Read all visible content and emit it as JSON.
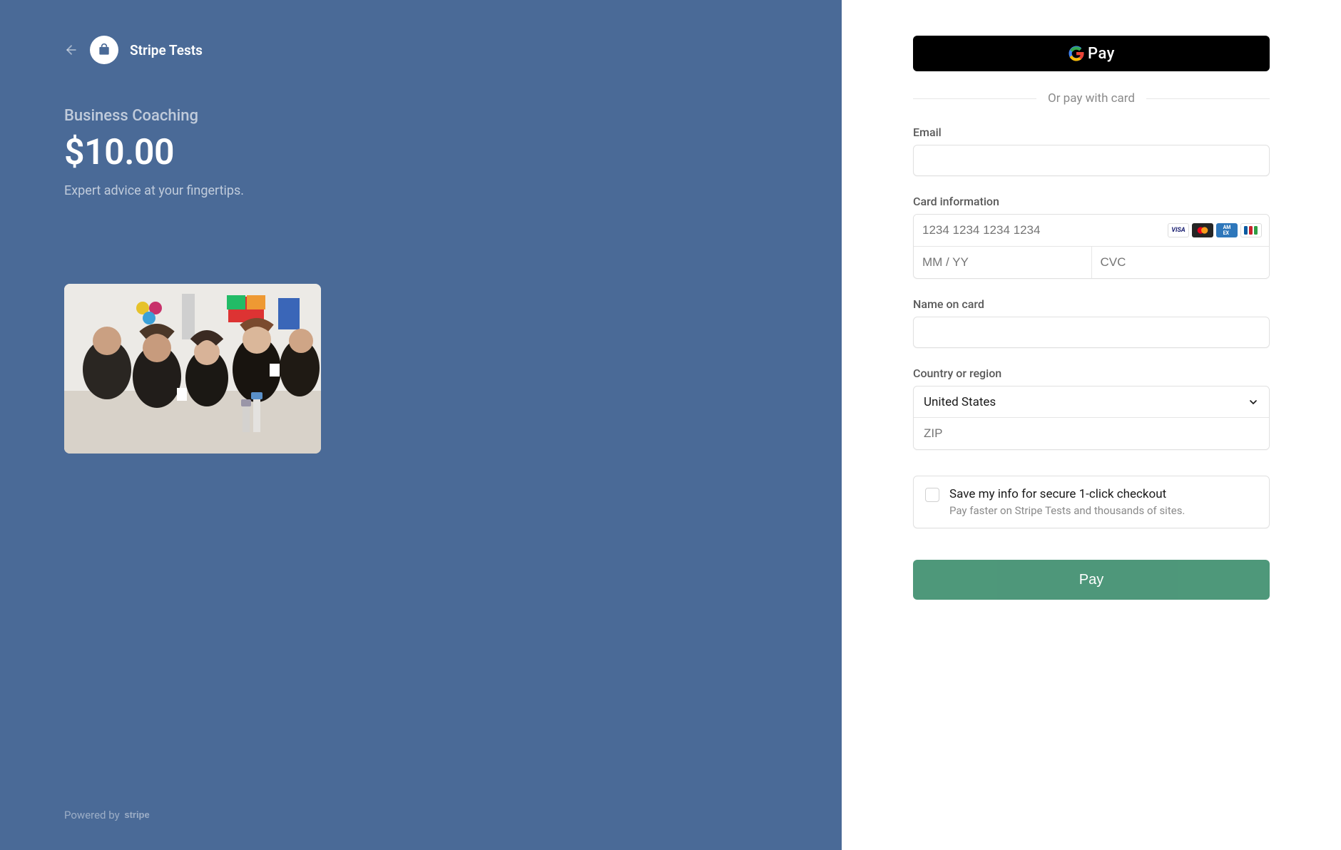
{
  "brand": {
    "name": "Stripe Tests"
  },
  "product": {
    "name": "Business Coaching",
    "price": "$10.00",
    "tagline": "Expert advice at your fingertips."
  },
  "footer": {
    "powered_by": "Powered by"
  },
  "payment": {
    "gpay_label": "Pay",
    "divider": "Or pay with card",
    "email_label": "Email",
    "card_label": "Card information",
    "card_number_placeholder": "1234 1234 1234 1234",
    "expiry_placeholder": "MM / YY",
    "cvc_placeholder": "CVC",
    "name_label": "Name on card",
    "country_label": "Country or region",
    "country_value": "United States",
    "zip_placeholder": "ZIP",
    "save_title": "Save my info for secure 1-click checkout",
    "save_sub": "Pay faster on Stripe Tests and thousands of sites.",
    "pay_button": "Pay"
  },
  "card_brands": [
    "VISA",
    "mastercard",
    "AMEX",
    "JCB"
  ]
}
